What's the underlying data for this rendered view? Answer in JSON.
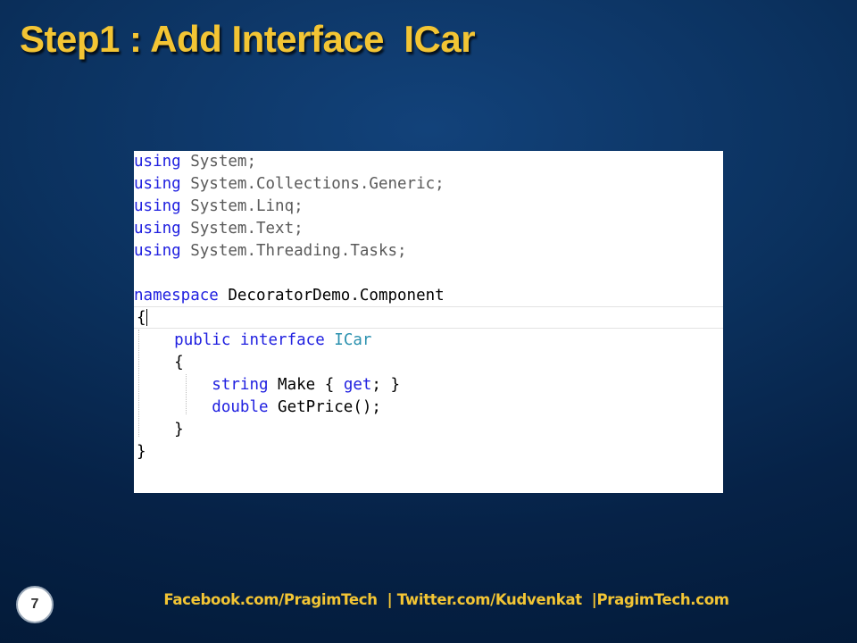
{
  "slide": {
    "title": "Step1 : Add Interface  ICar",
    "page_number": "7",
    "footer": "Facebook.com/PragimTech  | Twitter.com/Kudvenkat  |PragimTech.com"
  },
  "code": {
    "using_kw": "using",
    "ns1": " System;",
    "ns2": " System.Collections.Generic;",
    "ns3": " System.Linq;",
    "ns4": " System.Text;",
    "ns5": " System.Threading.Tasks;",
    "namespace_kw": "namespace",
    "namespace_name": " DecoratorDemo.Component",
    "open_brace": "{",
    "indent1": "    ",
    "public_kw": "public",
    "interface_kw": " interface ",
    "interface_name": "ICar",
    "inner_open_brace": "    {",
    "indent2": "        ",
    "string_kw": "string",
    "make_prefix": " Make { ",
    "get_kw": "get",
    "make_suffix": "; }",
    "double_kw": "double",
    "getprice": " GetPrice();",
    "inner_close_brace": "    }",
    "close_brace": "}"
  },
  "colors": {
    "title": "#f3c534",
    "keyword": "#2020e0",
    "type_name": "#2b91af",
    "using_namespace": "#5a5a5a",
    "background": "#0b315e"
  }
}
